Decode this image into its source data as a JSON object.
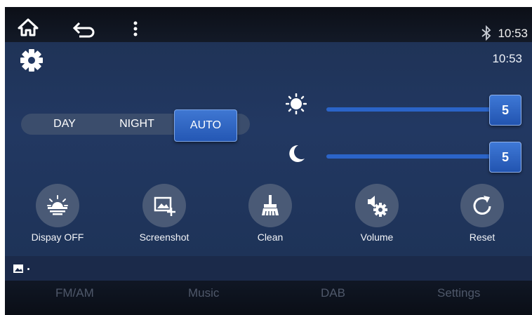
{
  "status_bar": {
    "time": "10:53",
    "icons": [
      "home-icon",
      "back-icon",
      "more-vert-icon",
      "bluetooth-icon"
    ]
  },
  "panel": {
    "time": "10:53",
    "icon": "gear-icon"
  },
  "display_mode": {
    "options": [
      "DAY",
      "NIGHT",
      "AUTO"
    ],
    "selected": "AUTO"
  },
  "brightness": {
    "day": {
      "icon": "sun-icon",
      "value": "5"
    },
    "night": {
      "icon": "moon-icon",
      "value": "5"
    }
  },
  "actions": [
    {
      "label": "Dispay OFF",
      "icon": "display-off-icon"
    },
    {
      "label": "Screenshot",
      "icon": "screenshot-icon"
    },
    {
      "label": "Clean",
      "icon": "broom-icon"
    },
    {
      "label": "Volume",
      "icon": "volume-settings-icon"
    },
    {
      "label": "Reset",
      "icon": "reset-icon"
    }
  ],
  "notification": {
    "icon": "image-icon"
  },
  "dock": [
    "FM/AM",
    "Music",
    "DAB",
    "Settings"
  ],
  "colors": {
    "accent": "#2b64c8",
    "panel_bg": "#223862",
    "button_bg": "#4a5a76"
  }
}
